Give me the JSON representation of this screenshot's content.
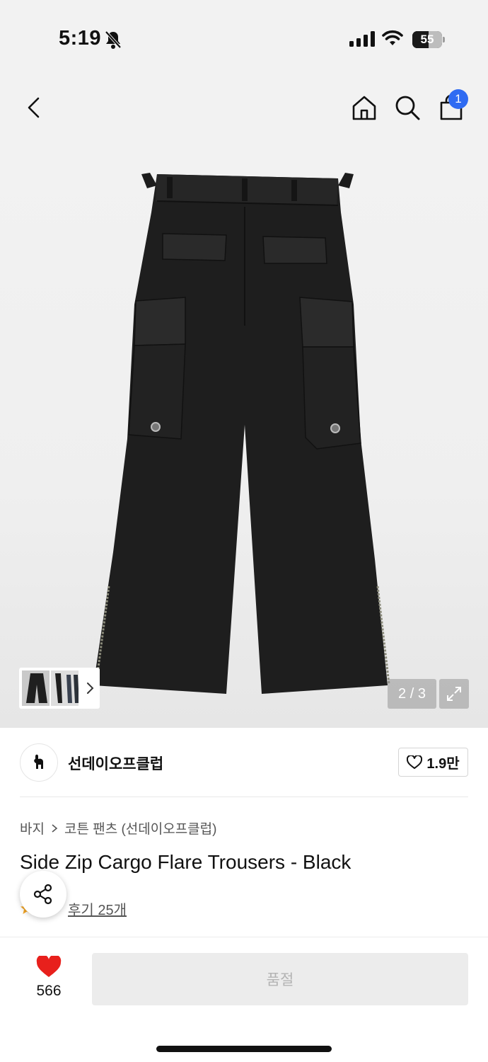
{
  "status_bar": {
    "time": "5:19",
    "battery_level": "55",
    "battery_fraction": 0.55,
    "icons": [
      "bell-muted-icon",
      "signal-icon",
      "wifi-icon",
      "battery-icon"
    ]
  },
  "top_nav": {
    "icons": [
      "back-chevron-icon",
      "home-icon",
      "search-icon",
      "shopping-bag-icon"
    ],
    "cart_count": "1"
  },
  "gallery": {
    "current": "2",
    "separator": "/",
    "total": "3",
    "icons": [
      "chevron-right-icon",
      "expand-icon"
    ]
  },
  "brand": {
    "name": "선데이오프클럽",
    "likes": "1.9만"
  },
  "breadcrumb": {
    "items": [
      "바지",
      "코튼 팬츠 (선데이오프클럽)"
    ]
  },
  "product": {
    "title": "Side Zip Cargo Flare Trousers - Black",
    "review_label": "후기 25개"
  },
  "bottom_bar": {
    "like_count": "566",
    "cta_label": "품절"
  },
  "colors": {
    "accent_blue": "#2f6bf2",
    "heart_red": "#e8201c",
    "disabled_gray": "#ececec"
  }
}
